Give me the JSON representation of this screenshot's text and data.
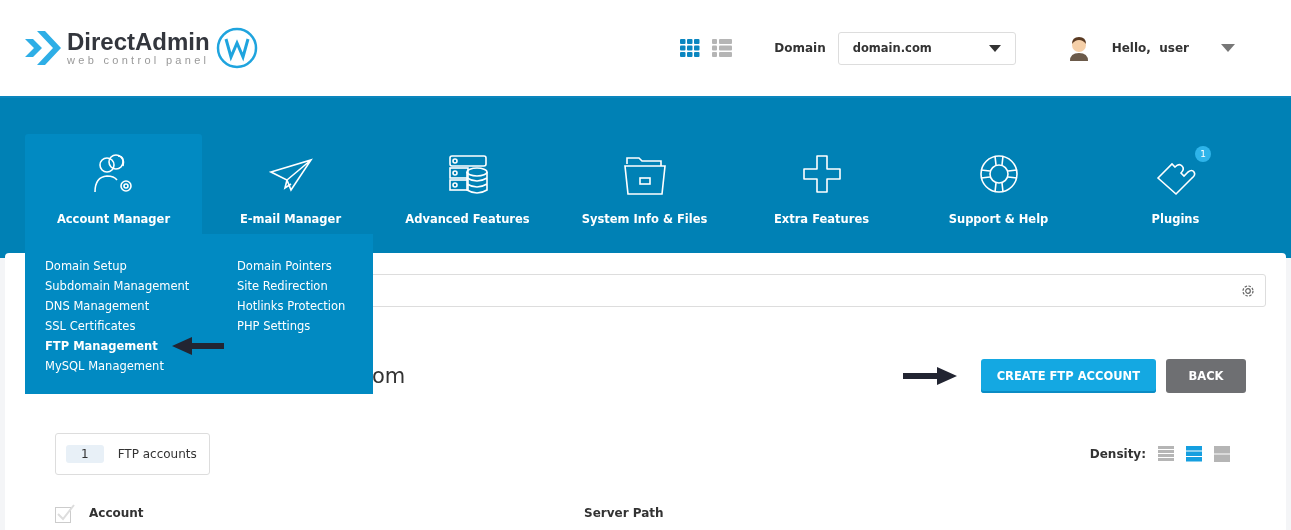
{
  "logo": {
    "name": "DirectAdmin",
    "tagline": "web control panel"
  },
  "header": {
    "domain_label": "Domain",
    "domain_value": "domain.com",
    "greeting": "Hello,",
    "user": "user",
    "view_modes": [
      {
        "kind": "grid",
        "selected": true
      },
      {
        "kind": "list",
        "selected": false
      }
    ]
  },
  "nav": [
    {
      "label": "Account Manager",
      "kind": "users",
      "selected": true
    },
    {
      "label": "E-mail Manager",
      "kind": "plane",
      "selected": false
    },
    {
      "label": "Advanced Features",
      "kind": "server",
      "selected": false
    },
    {
      "label": "System Info & Files",
      "kind": "folder",
      "selected": false
    },
    {
      "label": "Extra Features",
      "kind": "plus",
      "selected": false
    },
    {
      "label": "Support & Help",
      "kind": "lifebuoy",
      "selected": false
    },
    {
      "label": "Plugins",
      "kind": "puzzle",
      "selected": false,
      "badge": "1"
    }
  ],
  "menu": {
    "columns": [
      [
        {
          "label": "Domain Setup",
          "selected": false
        },
        {
          "label": "Subdomain Management",
          "selected": false
        },
        {
          "label": "DNS Management",
          "selected": false
        },
        {
          "label": "SSL Certificates",
          "selected": false
        },
        {
          "label": "FTP Management",
          "selected": true
        },
        {
          "label": "MySQL Management",
          "selected": false
        }
      ],
      [
        {
          "label": "Domain Pointers",
          "selected": false
        },
        {
          "label": "Site Redirection",
          "selected": false
        },
        {
          "label": "Hotlinks Protection",
          "selected": false
        },
        {
          "label": "PHP Settings",
          "selected": false
        }
      ]
    ]
  },
  "page_title": "om",
  "buttons": [
    {
      "label": "CREATE FTP ACCOUNT",
      "kind": "primary"
    },
    {
      "label": "BACK",
      "kind": "secondary"
    }
  ],
  "count": {
    "value": "1",
    "label": "FTP accounts"
  },
  "density": {
    "label": "Density:",
    "options": [
      {
        "kind": "compact",
        "selected": false
      },
      {
        "kind": "normal",
        "selected": true
      },
      {
        "kind": "wide",
        "selected": false
      }
    ]
  },
  "table": {
    "select_all_checked": false,
    "columns": [
      "Account",
      "Server Path"
    ]
  }
}
